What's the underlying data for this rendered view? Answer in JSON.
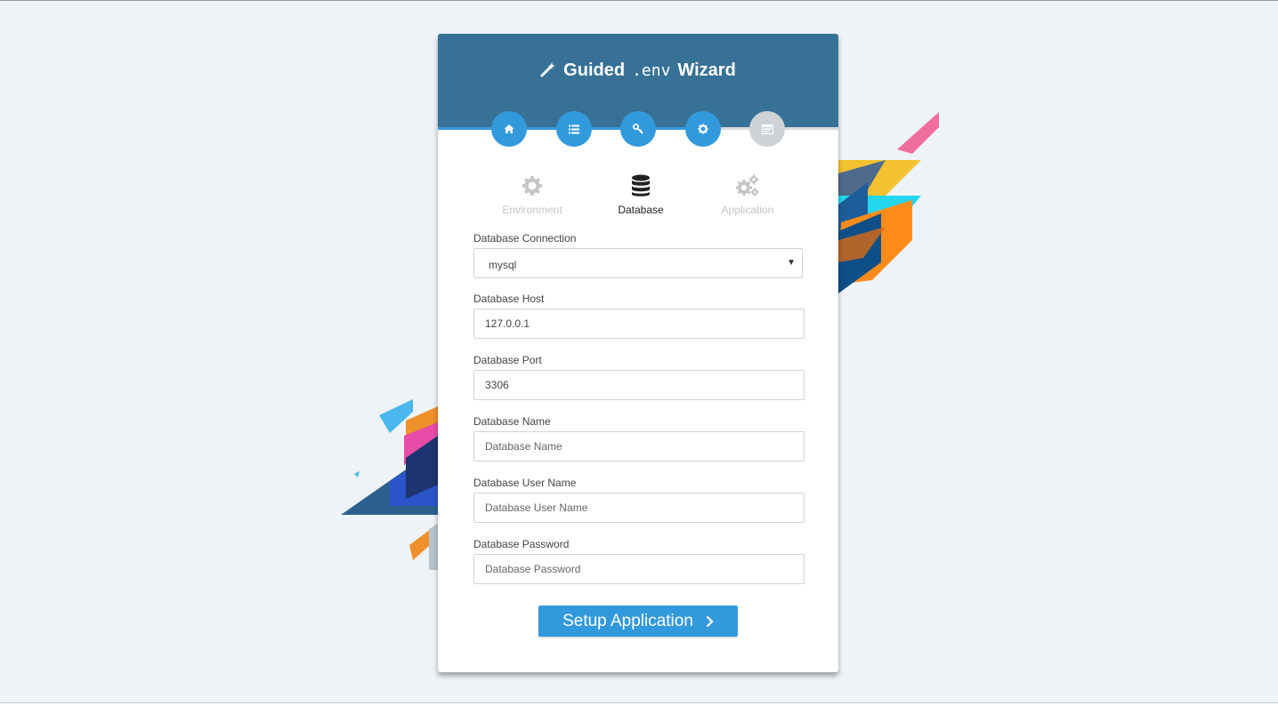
{
  "header": {
    "title_left": "Guided",
    "title_mono": ".env",
    "title_right": "Wizard",
    "icon": "magic-wand-icon"
  },
  "progress_steps": [
    {
      "icon": "home-icon",
      "state": "complete"
    },
    {
      "icon": "list-icon",
      "state": "complete"
    },
    {
      "icon": "key-icon",
      "state": "complete"
    },
    {
      "icon": "gear-icon",
      "state": "current"
    },
    {
      "icon": "server-icon",
      "state": "pending"
    }
  ],
  "sub_steps": [
    {
      "label": "Environment",
      "icon": "gear-icon",
      "active": false
    },
    {
      "label": "Database",
      "icon": "database-icon",
      "active": true
    },
    {
      "label": "Application",
      "icon": "gears-icon",
      "active": false
    }
  ],
  "form": {
    "connection": {
      "label": "Database Connection",
      "value": "mysql"
    },
    "host": {
      "label": "Database Host",
      "value": "127.0.0.1",
      "placeholder": "Database Host"
    },
    "port": {
      "label": "Database Port",
      "value": "3306",
      "placeholder": "Database Port"
    },
    "name": {
      "label": "Database Name",
      "value": "",
      "placeholder": "Database Name"
    },
    "user": {
      "label": "Database User Name",
      "value": "",
      "placeholder": "Database User Name"
    },
    "password": {
      "label": "Database Password",
      "value": "",
      "placeholder": "Database Password"
    }
  },
  "submit": {
    "label": "Setup Application",
    "icon": "chevron-right-icon"
  },
  "colors": {
    "header": "#377196",
    "accent": "#3399dd",
    "inactive": "#cdd2d6",
    "background": "#eef3f7"
  }
}
